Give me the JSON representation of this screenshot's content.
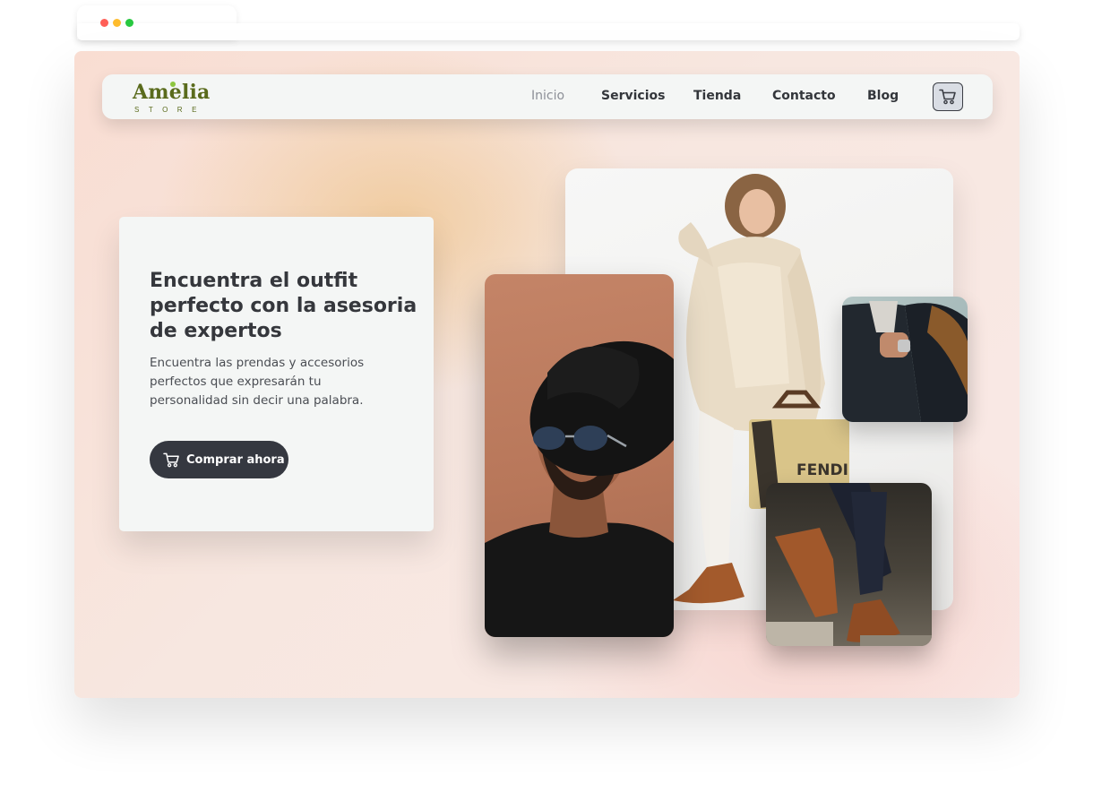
{
  "window": {
    "controls": [
      "close-dot",
      "minimize-dot",
      "maximize-dot"
    ],
    "colors": {
      "close": "#ff5f57",
      "minimize": "#febc2e",
      "maximize": "#28c840"
    }
  },
  "brand": {
    "name": "Amelia",
    "tagline": "STORE",
    "color": "#5a6b1c",
    "accent": "#8dc63f"
  },
  "nav": {
    "links": [
      {
        "label": "Inicio",
        "active": true
      },
      {
        "label": "Servicios",
        "active": false
      },
      {
        "label": "Tienda",
        "active": false
      },
      {
        "label": "Contacto",
        "active": false
      },
      {
        "label": "Blog",
        "active": false
      }
    ],
    "cart_icon": "cart-icon"
  },
  "hero": {
    "title": "Encuentra el outfit perfecto con la asesoria de expertos",
    "description": "Encuentra las prendas y accesorios perfectos que expresarán tu personalidad sin decir una palabra.",
    "cta_label": "Comprar ahora",
    "cta_icon": "cart-icon"
  },
  "gallery": {
    "bag_text": "FENDI"
  },
  "colors": {
    "dark": "#353840",
    "text": "#33363b",
    "muted": "#8c8f97",
    "card_bg": "#f4f6f5"
  }
}
